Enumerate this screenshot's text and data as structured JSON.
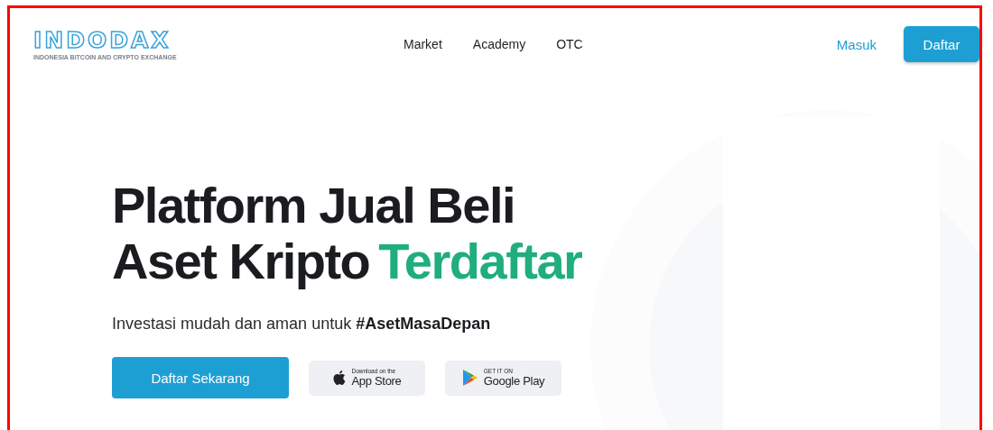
{
  "logo": {
    "name": "INDODAX",
    "tagline": "INDONESIA BITCOIN AND CRYPTO EXCHANGE"
  },
  "nav": [
    "Market",
    "Academy",
    "OTC"
  ],
  "auth": {
    "login": "Masuk",
    "register": "Daftar"
  },
  "hero": {
    "line_1": "Platform Jual Beli",
    "line_2": "Aset Kripto",
    "highlight": "Terdaftar",
    "subtitle": "Investasi mudah dan aman untuk **#AsetMasaDepan**",
    "cta": "Daftar Sekarang",
    "stores": [
      {
        "kind": "apple",
        "small": "Download on the",
        "big": "App Store"
      },
      {
        "kind": "google",
        "small": "GET IT ON",
        "big": "Google Play"
      }
    ]
  }
}
